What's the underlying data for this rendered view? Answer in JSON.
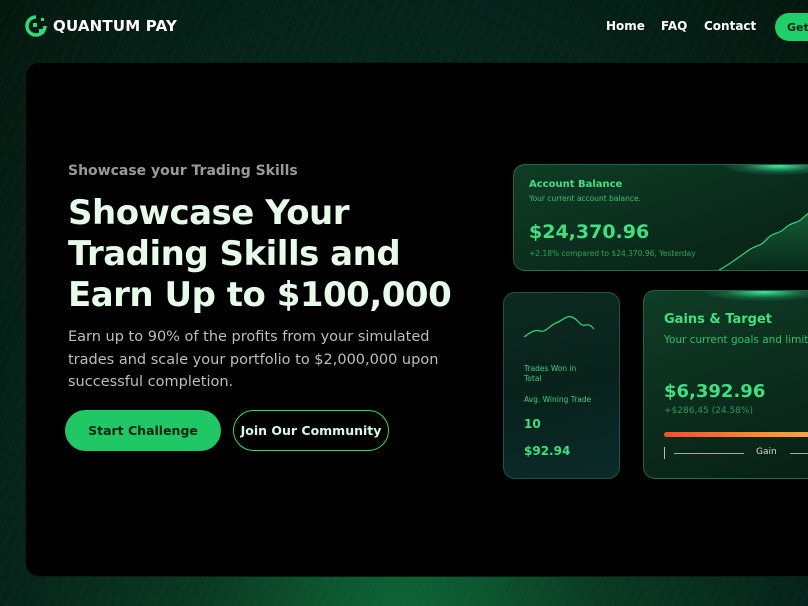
{
  "brand": {
    "name": "QUANTUM PAY"
  },
  "nav": {
    "links": [
      "Home",
      "FAQ",
      "Contact"
    ],
    "cta_label": "Get S"
  },
  "hero": {
    "eyebrow": "Showcase your Trading Skills",
    "headline": [
      "Showcase Your",
      "Trading Skills and",
      "Earn Up to $100,000"
    ],
    "subtext": "Earn up to 90% of the profits from your simulated trades and scale your portfolio to $2,000,000 upon successful completion.",
    "primary_button": "Start Challenge",
    "secondary_button": "Join Our Community"
  },
  "balance_card": {
    "title": "Account Balance",
    "subtitle": "Your current account balance.",
    "value": "$24,370.96",
    "change": "+2.18% compared to $24,370.96, Yesterday"
  },
  "trades_card": {
    "label_won": "Trades Won in Total",
    "label_avg": "Avg. Wining Trade",
    "value_won": "10",
    "value_avg": "$92.94"
  },
  "gains_card": {
    "title": "Gains & Target",
    "subtitle": "Your current goals and limits",
    "value": "$6,392.96",
    "change": "+$286,45 (24.58%)",
    "scale_label": "Gain"
  },
  "colors": {
    "accent": "#1fc765",
    "accent_text": "#3ee07f",
    "hero_bg": "#000000",
    "page_bg": "#06231a",
    "bar_start": "#ff4a2e",
    "bar_end": "#ffb35a"
  }
}
